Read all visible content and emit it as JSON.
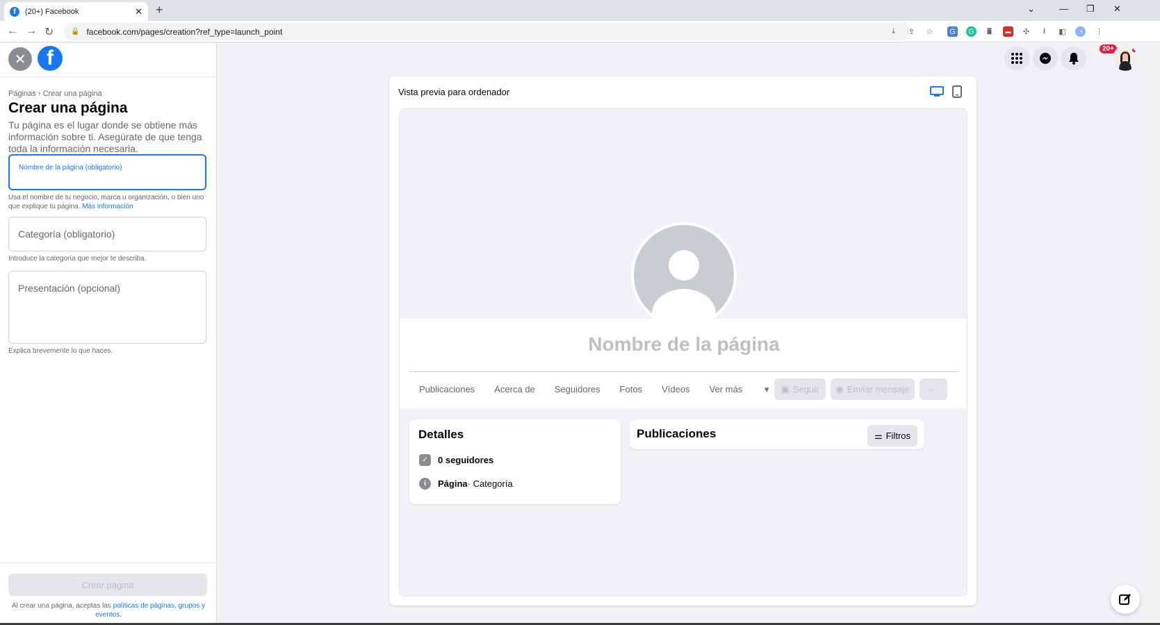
{
  "browser": {
    "tab_title": "(20+) Facebook",
    "url": "facebook.com/pages/creation?ref_type=launch_point"
  },
  "left": {
    "breadcrumb_pages": "Páginas",
    "breadcrumb_sep": "›",
    "breadcrumb_current": "Crear una página",
    "title": "Crear una página",
    "description": "Tu página es el lugar donde se obtiene más información sobre ti. Asegúrate de que tenga toda la información necesaria.",
    "name_placeholder": "Nombre de la página (obligatorio)",
    "name_help": "Usa el nombre de tu negocio, marca u organización, o bien uno que explique tu página.",
    "name_help_link": "Más información",
    "category_placeholder": "Categoría (obligatorio)",
    "category_help": "Introduce la categoría que mejor te describa.",
    "bio_placeholder": "Presentación (opcional)",
    "bio_help": "Explica brevemente lo que haces.",
    "create_button": "Crear página",
    "terms_prefix": "Al crear una página, aceptas las",
    "terms_link": "políticas de páginas, grupos y eventos",
    "terms_suffix": "."
  },
  "topbar": {
    "notifications_badge": "20+"
  },
  "preview": {
    "label": "Vista previa para ordenador",
    "page_name": "Nombre de la página",
    "tabs": [
      "Publicaciones",
      "Acerca de",
      "Seguidores",
      "Fotos",
      "Vídeos",
      "Ver más"
    ],
    "follow_button": "Seguir",
    "message_button": "Enviar mensaje",
    "more_button": "···",
    "details_title": "Detalles",
    "followers": "0 seguidores",
    "page_type_bold": "Página",
    "page_type_rest": " · Categoría",
    "posts_title": "Publicaciones",
    "filters_button": "Filtros"
  },
  "colors": {
    "facebook_blue": "#1877f2",
    "badge_red": "#e41e3f",
    "background": "#f0f2f5"
  }
}
